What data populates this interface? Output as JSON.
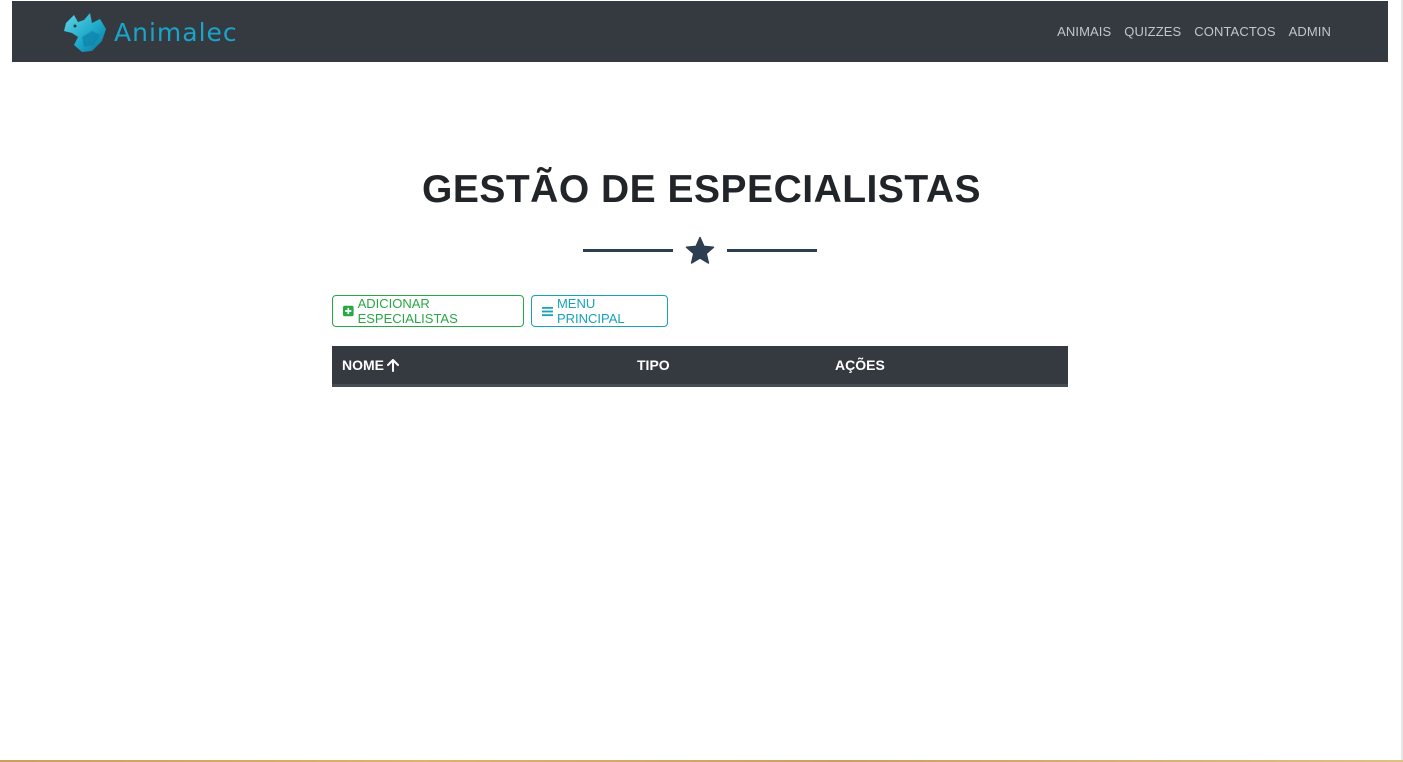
{
  "navbar": {
    "brand": "Animalec",
    "links": [
      "ANIMAIS",
      "QUIZZES",
      "CONTACTOS",
      "ADMIN"
    ],
    "background": "#343a40",
    "brand_color": "#19a4c9"
  },
  "page": {
    "title": "GESTÃO DE ESPECIALISTAS",
    "divider_icon": "star-icon"
  },
  "actions": {
    "add_label": "ADICIONAR ESPECIALISTAS",
    "add_icon": "plus-square-icon",
    "add_color": "#28a745",
    "menu_label": "MENU PRINCIPAL",
    "menu_icon": "bars-icon",
    "menu_color": "#17a2b8"
  },
  "table": {
    "columns": [
      "NOME",
      "TIPO",
      "AÇÕES"
    ],
    "sort_icon": "arrow-up-icon",
    "rows": []
  }
}
